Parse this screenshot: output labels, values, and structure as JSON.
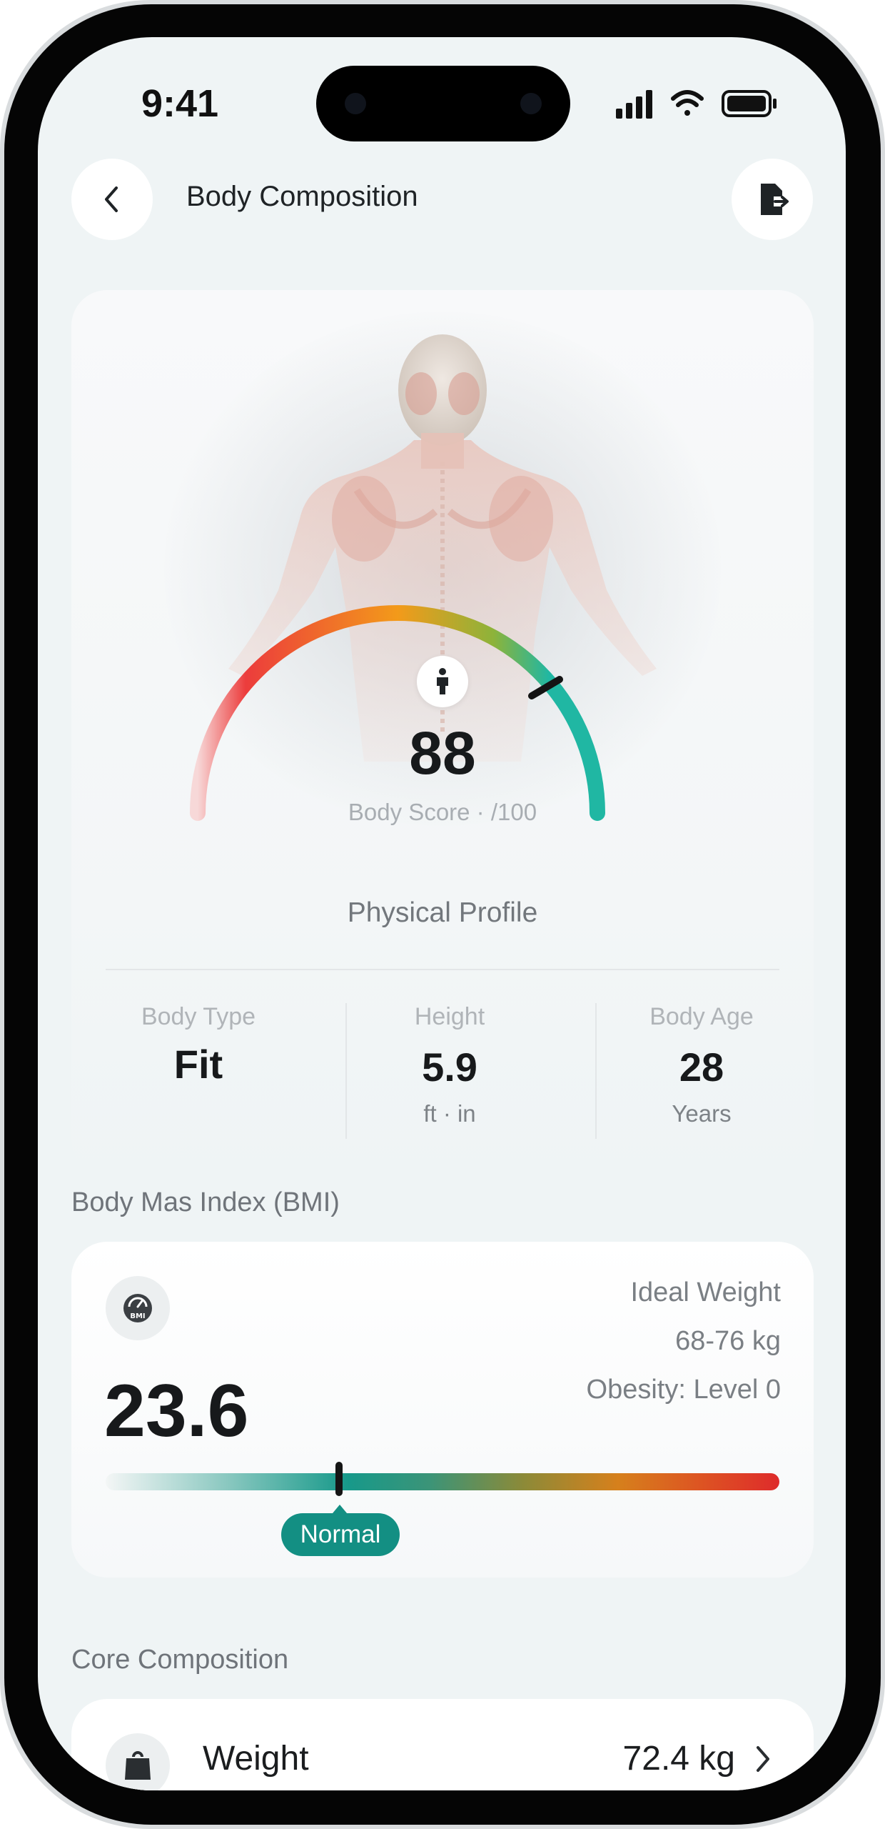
{
  "status_bar": {
    "time": "9:41"
  },
  "header": {
    "title": "Body Composition"
  },
  "score": {
    "value": "88",
    "label": "Body Score · /100",
    "level": 0.88
  },
  "profile": {
    "title": "Physical Profile",
    "stats": [
      {
        "label": "Body Type",
        "value": "Fit",
        "unit": ""
      },
      {
        "label": "Height",
        "value": "5.9",
        "unit": "ft · in"
      },
      {
        "label": "Body Age",
        "value": "28",
        "unit": "Years"
      }
    ]
  },
  "bmi": {
    "section_label": "Body Mas Index (BMI)",
    "value": "23.6",
    "ideal_weight_label": "Ideal Weight",
    "ideal_weight_value": "68-76 kg",
    "obesity": "Obesity: Level 0",
    "status": "Normal",
    "status_color": "#138f83"
  },
  "core": {
    "section_label": "Core Composition",
    "items": [
      {
        "label": "Weight",
        "value": "72.4 kg"
      }
    ]
  },
  "colors": {
    "background": "#eff4f5",
    "card": "#ffffff",
    "gauge_start": "#ec3c3c",
    "gauge_mid": "#f39a1a",
    "gauge_end": "#20b7a3",
    "text_primary": "#17191b",
    "text_secondary": "#7a7f84"
  },
  "icons": {
    "back": "chevron-left-icon",
    "export": "file-export-icon",
    "gauge_center": "person-icon",
    "bmi": "bmi-gauge-icon",
    "weight": "weight-bag-icon",
    "weight_action": "chevron-right-icon"
  }
}
